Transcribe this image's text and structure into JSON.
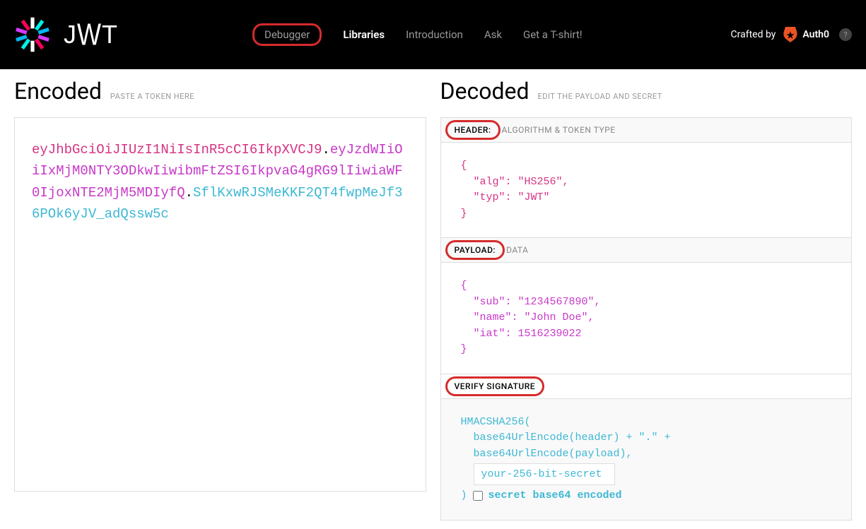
{
  "header": {
    "logo_text": "JWT",
    "nav": {
      "debugger": "Debugger",
      "libraries": "Libraries",
      "introduction": "Introduction",
      "ask": "Ask",
      "tshirt": "Get a T-shirt!"
    },
    "crafted_by": "Crafted by",
    "auth0": "Auth0"
  },
  "encoded": {
    "title": "Encoded",
    "subtitle": "PASTE A TOKEN HERE",
    "token_header": "eyJhbGciOiJIUzI1NiIsInR5cCI6IkpXVCJ9",
    "token_payload": "eyJzdWIiOiIxMjM0NTY3ODkwIiwibmFtZSI6IkpvaG4gRG9lIiwiaWF0IjoxNTE2MjM5MDIyfQ",
    "token_signature": "SflKxwRJSMeKKF2QT4fwpMeJf36POk6yJV_adQssw5c"
  },
  "decoded": {
    "title": "Decoded",
    "subtitle": "EDIT THE PAYLOAD AND SECRET",
    "header_section": {
      "label": "HEADER:",
      "hint": "ALGORITHM & TOKEN TYPE",
      "json": "{\n  \"alg\": \"HS256\",\n  \"typ\": \"JWT\"\n}"
    },
    "payload_section": {
      "label": "PAYLOAD:",
      "hint": "DATA",
      "json": "{\n  \"sub\": \"1234567890\",\n  \"name\": \"John Doe\",\n  \"iat\": 1516239022\n}"
    },
    "signature_section": {
      "label": "VERIFY SIGNATURE",
      "line1": "HMACSHA256(",
      "line2": "base64UrlEncode(header) + \".\" +",
      "line3": "base64UrlEncode(payload),",
      "secret_value": "your-256-bit-secret",
      "closing": ")",
      "checkbox_label": "secret base64 encoded"
    }
  }
}
